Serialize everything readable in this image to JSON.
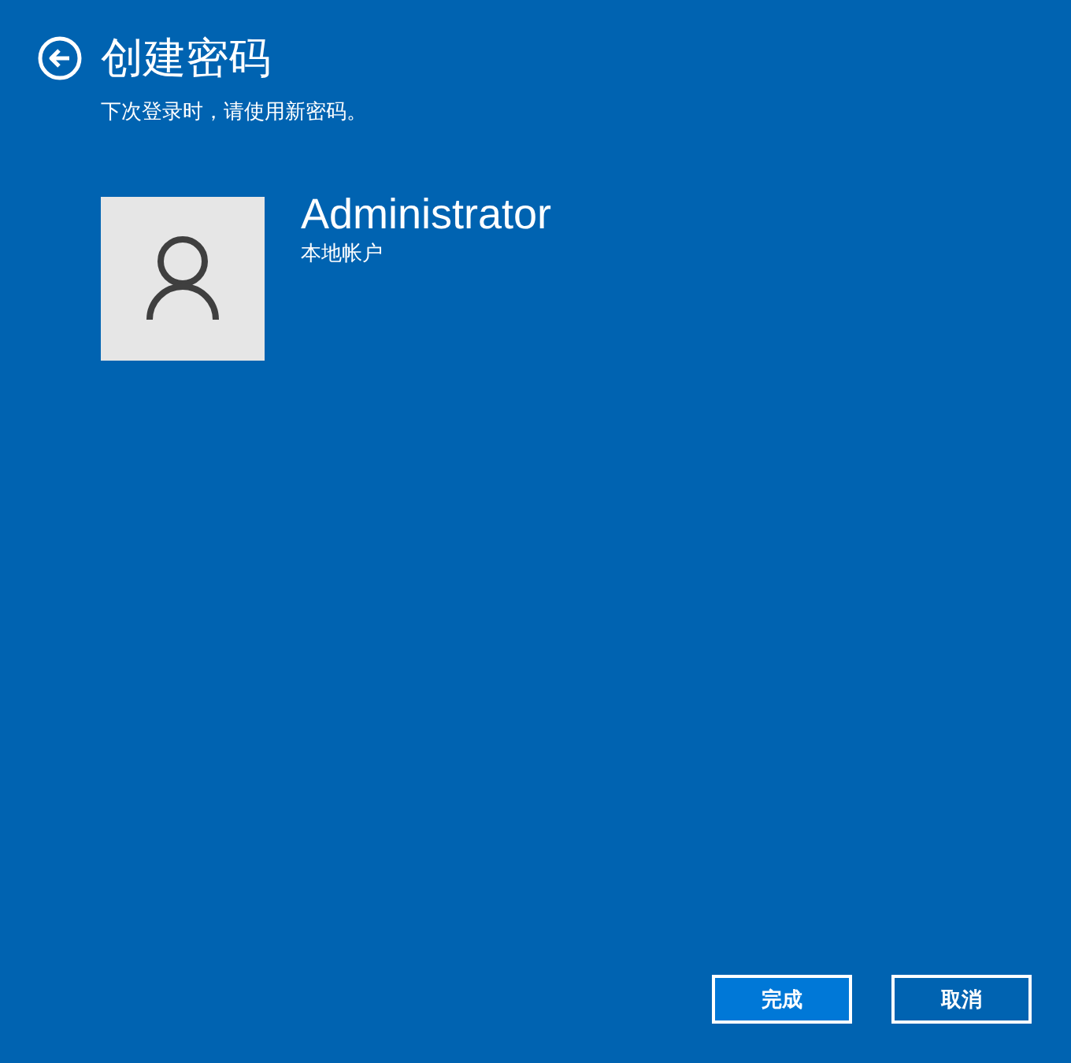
{
  "header": {
    "title": "创建密码",
    "subtitle": "下次登录时，请使用新密码。"
  },
  "account": {
    "name": "Administrator",
    "type": "本地帐户"
  },
  "buttons": [
    {
      "label": "完成",
      "kind": "primary"
    },
    {
      "label": "取消",
      "kind": "secondary"
    }
  ]
}
